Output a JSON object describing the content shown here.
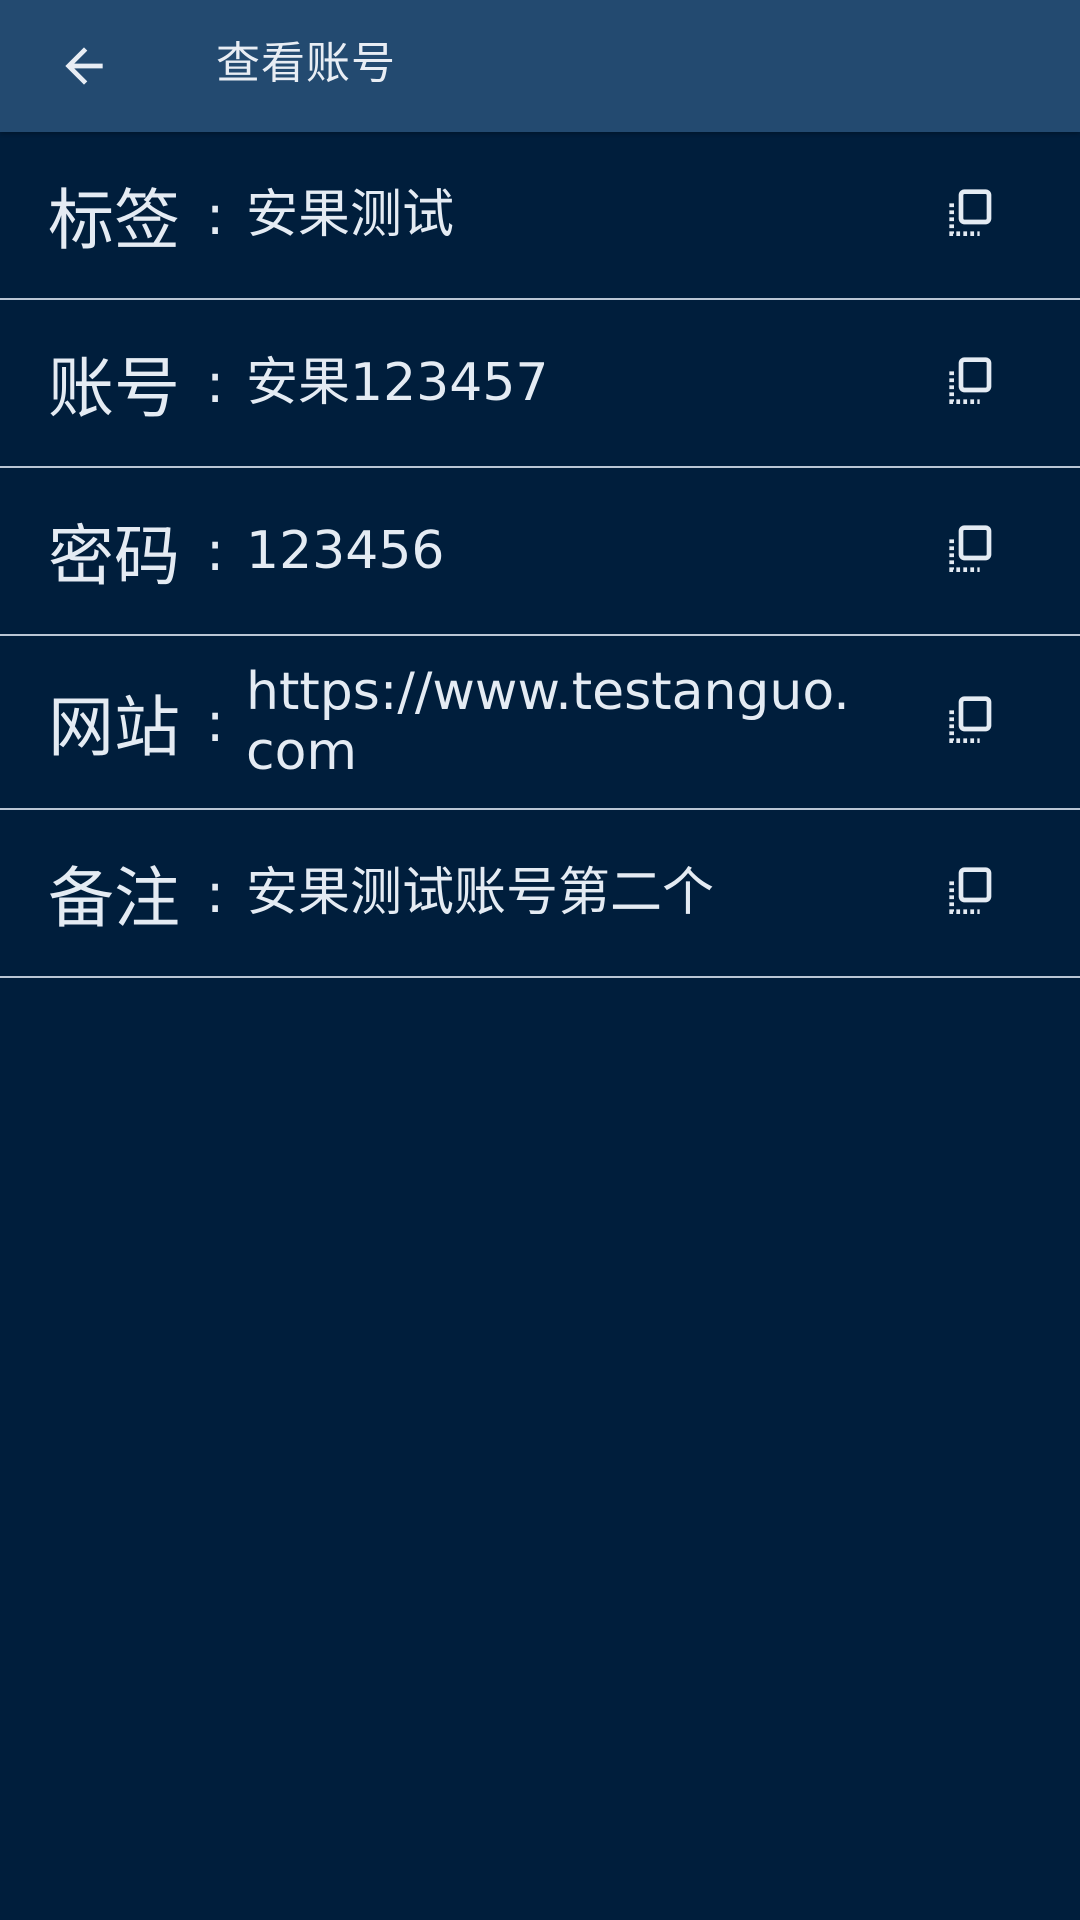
{
  "toolbar": {
    "back_icon": "arrow-left-icon",
    "title": "查看账号"
  },
  "colors": {
    "toolbar_bg": "#234a70",
    "page_bg": "#001e3c",
    "text": "#e4ebf3",
    "divider": "#b9c6d4"
  },
  "fields": [
    {
      "key": "label",
      "label": "标签",
      "colon": ":",
      "value": "安果测试",
      "copy_icon": "copy-icon"
    },
    {
      "key": "account",
      "label": "账号",
      "colon": ":",
      "value": "安果123457",
      "copy_icon": "copy-icon"
    },
    {
      "key": "password",
      "label": "密码",
      "colon": ":",
      "value": "123456",
      "copy_icon": "copy-icon"
    },
    {
      "key": "website",
      "label": "网站",
      "colon": ":",
      "value": "https://www.testanguo.com",
      "copy_icon": "copy-icon"
    },
    {
      "key": "note",
      "label": "备注",
      "colon": ":",
      "value": "安果测试账号第二个",
      "copy_icon": "copy-icon"
    }
  ]
}
